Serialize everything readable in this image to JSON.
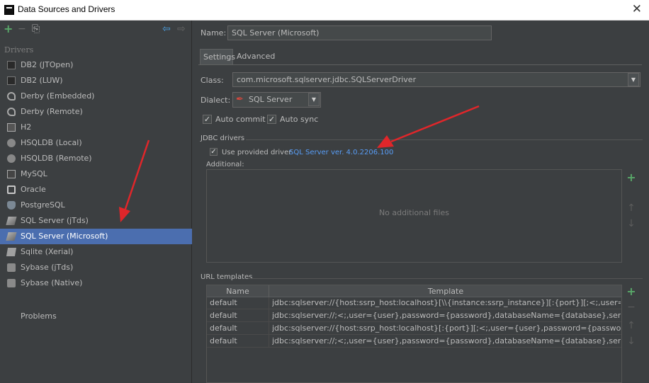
{
  "window": {
    "title": "Data Sources and Drivers",
    "close_glyph": "✕"
  },
  "toolbar": {
    "add_glyph": "+",
    "remove_glyph": "−",
    "copy_glyph": "⎘",
    "back_glyph": "⇦",
    "forward_glyph": "⇨"
  },
  "sidebar": {
    "section_label": "Drivers",
    "items": [
      {
        "label": "DB2 (JTOpen)",
        "icon": "db2-icon"
      },
      {
        "label": "DB2 (LUW)",
        "icon": "db2-icon"
      },
      {
        "label": "Derby (Embedded)",
        "icon": "derby-icon"
      },
      {
        "label": "Derby (Remote)",
        "icon": "derby-icon"
      },
      {
        "label": "H2",
        "icon": "h2-icon"
      },
      {
        "label": "HSQLDB (Local)",
        "icon": "hsqldb-icon"
      },
      {
        "label": "HSQLDB (Remote)",
        "icon": "hsqldb-icon"
      },
      {
        "label": "MySQL",
        "icon": "mysql-icon"
      },
      {
        "label": "Oracle",
        "icon": "oracle-icon"
      },
      {
        "label": "PostgreSQL",
        "icon": "postgresql-icon"
      },
      {
        "label": "SQL Server (jTds)",
        "icon": "sqlserver-icon"
      },
      {
        "label": "SQL Server (Microsoft)",
        "icon": "sqlserver-icon",
        "selected": true
      },
      {
        "label": "Sqlite (Xerial)",
        "icon": "sqlite-icon"
      },
      {
        "label": "Sybase (jTds)",
        "icon": "sybase-icon"
      },
      {
        "label": "Sybase (Native)",
        "icon": "sybase-icon"
      }
    ],
    "problems_label": "Problems"
  },
  "main": {
    "name_label": "Name:",
    "name_value": "SQL Server (Microsoft)",
    "tabs": [
      {
        "label": "Settings",
        "active": true
      },
      {
        "label": "Advanced",
        "active": false
      }
    ],
    "class_label": "Class:",
    "class_value": "com.microsoft.sqlserver.jdbc.SQLServerDriver",
    "dialect_label": "Dialect:",
    "dialect_value": "SQL Server",
    "auto_commit_label": "Auto commit",
    "auto_commit": true,
    "auto_sync_label": "Auto sync",
    "auto_sync": true,
    "jdbc_section": "JDBC drivers",
    "use_provided_label": "Use provided driver",
    "use_provided": true,
    "driver_link": "SQL Server ver. 4.0.2206.100",
    "additional_label": "Additional:",
    "no_files": "No additional files",
    "url_section": "URL templates",
    "url_table": {
      "columns": [
        "Name",
        "Template"
      ],
      "rows": [
        {
          "name": "default",
          "template": "jdbc:sqlserver://{host:ssrp_host:localhost}[\\\\{instance:ssrp_instance}][:{port}][;<;,user={user:par..."
        },
        {
          "name": "default",
          "template": "jdbc:sqlserver://;<;,user={user},password={password},databaseName={database},servername..."
        },
        {
          "name": "default",
          "template": "jdbc:sqlserver://{host:ssrp_host:localhost}[:{port}][;<;,user={user},password={password},databa..."
        },
        {
          "name": "default",
          "template": "jdbc:sqlserver://;<;,user={user},password={password},databaseName={database},servername..."
        }
      ]
    }
  },
  "colors": {
    "background": "#3c3f41",
    "selection": "#4b6eaf",
    "link": "#589df6",
    "add_green": "#59a869",
    "annotation_arrow": "#e0262a"
  }
}
